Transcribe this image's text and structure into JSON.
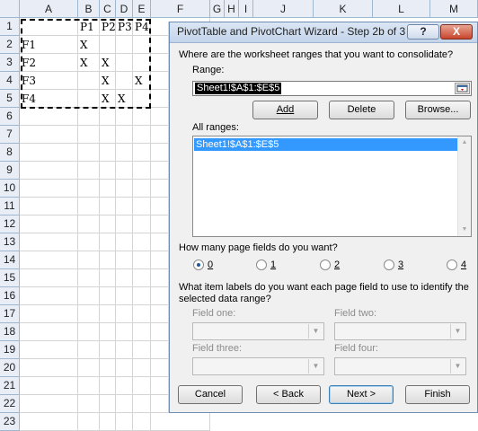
{
  "spreadsheet": {
    "columns": [
      "A",
      "B",
      "C",
      "D",
      "E",
      "F",
      "G",
      "H",
      "I",
      "J",
      "K",
      "L",
      "M"
    ],
    "rows": [
      "1",
      "2",
      "3",
      "4",
      "5",
      "6",
      "7",
      "8",
      "9",
      "10",
      "11",
      "12",
      "13",
      "14",
      "15",
      "16",
      "17",
      "18",
      "19",
      "20",
      "21",
      "22",
      "23"
    ],
    "cells": {
      "r1": {
        "b": "P1",
        "c": "P2",
        "d": "P3",
        "e": "P4"
      },
      "r2": {
        "a": "F1",
        "b": "X",
        "c": "",
        "d": "",
        "e": ""
      },
      "r3": {
        "a": "F2",
        "b": "X",
        "c": "X",
        "d": "",
        "e": ""
      },
      "r4": {
        "a": "F3",
        "b": "",
        "c": "X",
        "d": "",
        "e": "X"
      },
      "r5": {
        "a": "F4",
        "b": "",
        "c": "X",
        "d": "X",
        "e": ""
      }
    }
  },
  "dialog": {
    "title": "PivotTable and PivotChart Wizard - Step 2b of 3",
    "help_btn": "?",
    "close_btn": "X",
    "question1": "Where are the worksheet ranges that you want to consolidate?",
    "range_label": "Range:",
    "range_value": "Sheet1!$A$1:$E$5",
    "add_btn": "Add",
    "delete_btn": "Delete",
    "browse_btn": "Browse...",
    "all_ranges_label": "All ranges:",
    "all_ranges_items": [
      "Sheet1!$A$1:$E$5"
    ],
    "page_fields_question": "How many page fields do you want?",
    "page_field_options": [
      "0",
      "1",
      "2",
      "3",
      "4"
    ],
    "page_fields_selected": "0",
    "item_labels_question": "What item labels do you want each page field to use to identify the selected data range?",
    "field_one": "Field one:",
    "field_two": "Field two:",
    "field_three": "Field three:",
    "field_four": "Field four:",
    "cancel_btn": "Cancel",
    "back_btn": "< Back",
    "next_btn": "Next >",
    "finish_btn": "Finish"
  }
}
